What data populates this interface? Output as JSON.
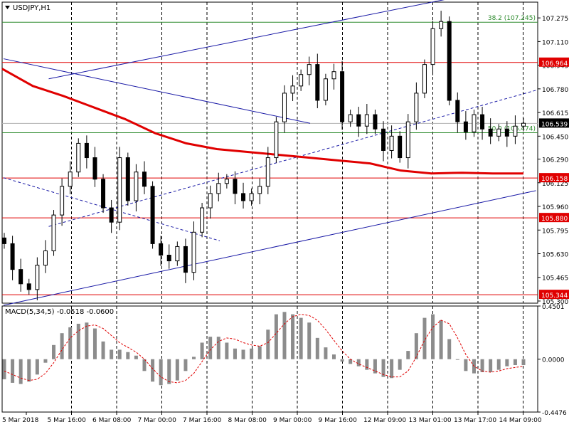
{
  "chart_data": [
    {
      "type": "candlestick",
      "title": "USDJPY,H1",
      "symbol": "USDJPY",
      "timeframe": "H1",
      "y_ticks": [
        107.275,
        107.11,
        106.945,
        106.78,
        106.615,
        106.45,
        106.29,
        106.125,
        105.96,
        105.795,
        105.63,
        105.465,
        105.3
      ],
      "ylim": [
        105.285,
        107.385
      ],
      "x_ticks": [
        "5 Mar 2018",
        "5 Mar 16:00",
        "6 Mar 08:00",
        "7 Mar 00:00",
        "7 Mar 16:00",
        "8 Mar 08:00",
        "9 Mar 00:00",
        "9 Mar 16:00",
        "12 Mar 09:00",
        "13 Mar 01:00",
        "13 Mar 17:00",
        "14 Mar 09:00"
      ],
      "grid": true,
      "current_price": 106.539,
      "current_price_label": "106.539",
      "horizontal_levels": [
        {
          "value": 106.964,
          "label": "106.964",
          "color": "#e00000"
        },
        {
          "value": 106.158,
          "label": "106.158",
          "color": "#e00000"
        },
        {
          "value": 105.88,
          "label": "105.880",
          "color": "#e00000"
        },
        {
          "value": 105.344,
          "label": "105.344",
          "color": "#e00000"
        }
      ],
      "fibonacci_levels": [
        {
          "value": 107.245,
          "label": "38.2 (107.245)",
          "color": "#2e8b2e"
        },
        {
          "value": 106.474,
          "label": "50.0 (106.474)",
          "color": "#2e8b2e"
        }
      ],
      "trend_lines": [
        {
          "from": [
            "5 Mar 2018",
            106.99
          ],
          "to": [
            "9 Mar 00:00",
            106.54
          ]
        },
        {
          "from": [
            "5 Mar 2018",
            106.16
          ],
          "to": [
            "7 Mar 16:00",
            105.72
          ],
          "style": "dashed"
        },
        {
          "from": [
            "5 Mar 16:00",
            105.82
          ],
          "to": [
            "14 Mar 09:00",
            106.77
          ],
          "style": "dashed"
        },
        {
          "from": [
            "5 Mar 16:00",
            106.85
          ],
          "to": [
            "14 Mar 09:00",
            107.53
          ]
        },
        {
          "from": [
            "5 Mar 2018",
            105.27
          ],
          "to": [
            "14 Mar 09:00",
            106.07
          ]
        }
      ],
      "moving_average": {
        "color": "#e00000",
        "values": [
          106.92,
          106.8,
          106.73,
          106.65,
          106.57,
          106.47,
          106.4,
          106.36,
          106.34,
          106.32,
          106.3,
          106.28,
          106.26,
          106.21,
          106.19,
          106.195,
          106.19,
          106.19
        ]
      },
      "close_path": [
        105.7,
        105.52,
        105.42,
        105.38,
        105.55,
        105.65,
        105.9,
        106.1,
        106.2,
        106.4,
        106.3,
        106.15,
        105.95,
        105.85,
        106.3,
        106.0,
        106.2,
        106.1,
        105.7,
        105.62,
        105.58,
        105.68,
        105.5,
        105.78,
        105.95,
        106.05,
        106.12,
        106.15,
        106.05,
        106.0,
        106.05,
        106.1,
        106.3,
        106.55,
        106.75,
        106.8,
        106.88,
        106.95,
        106.7,
        106.85,
        106.9,
        106.55,
        106.6,
        106.52,
        106.6,
        106.5,
        106.35,
        106.45,
        106.3,
        106.55,
        106.75,
        106.95,
        107.2,
        107.25,
        106.7,
        106.55,
        106.48,
        106.6,
        106.5,
        106.45,
        106.5,
        106.45,
        106.52,
        106.54
      ]
    },
    {
      "type": "bar",
      "title": "MACD(5,34,5) -0.0518 -0.0600",
      "y_ticks": [
        0.4501,
        0.0,
        -0.4476
      ],
      "ylim": [
        -0.4476,
        0.4501
      ],
      "main_values": [
        -0.17,
        -0.2,
        -0.21,
        -0.19,
        -0.13,
        -0.03,
        0.12,
        0.22,
        0.27,
        0.3,
        0.31,
        0.26,
        0.15,
        0.08,
        0.08,
        0.06,
        0.03,
        -0.1,
        -0.19,
        -0.22,
        -0.21,
        -0.18,
        -0.1,
        0.02,
        0.14,
        0.19,
        0.19,
        0.14,
        0.09,
        0.08,
        0.09,
        0.11,
        0.25,
        0.38,
        0.4,
        0.38,
        0.35,
        0.31,
        0.18,
        0.1,
        0.04,
        -0.02,
        -0.04,
        -0.06,
        -0.09,
        -0.12,
        -0.15,
        -0.16,
        -0.09,
        0.07,
        0.22,
        0.35,
        0.38,
        0.33,
        0.17,
        0.0,
        -0.1,
        -0.12,
        -0.11,
        -0.11,
        -0.09,
        -0.06,
        -0.05,
        -0.05
      ],
      "signal_values": [
        -0.1,
        -0.13,
        -0.16,
        -0.18,
        -0.17,
        -0.12,
        -0.03,
        0.08,
        0.18,
        0.24,
        0.28,
        0.29,
        0.26,
        0.2,
        0.14,
        0.1,
        0.06,
        0.0,
        -0.08,
        -0.15,
        -0.19,
        -0.2,
        -0.18,
        -0.12,
        -0.02,
        0.08,
        0.15,
        0.18,
        0.17,
        0.14,
        0.12,
        0.11,
        0.14,
        0.22,
        0.3,
        0.36,
        0.38,
        0.37,
        0.33,
        0.25,
        0.16,
        0.07,
        0.0,
        -0.04,
        -0.07,
        -0.1,
        -0.13,
        -0.15,
        -0.15,
        -0.1,
        0.02,
        0.16,
        0.27,
        0.33,
        0.3,
        0.18,
        0.04,
        -0.06,
        -0.1,
        -0.11,
        -0.1,
        -0.08,
        -0.07,
        -0.06
      ]
    }
  ]
}
